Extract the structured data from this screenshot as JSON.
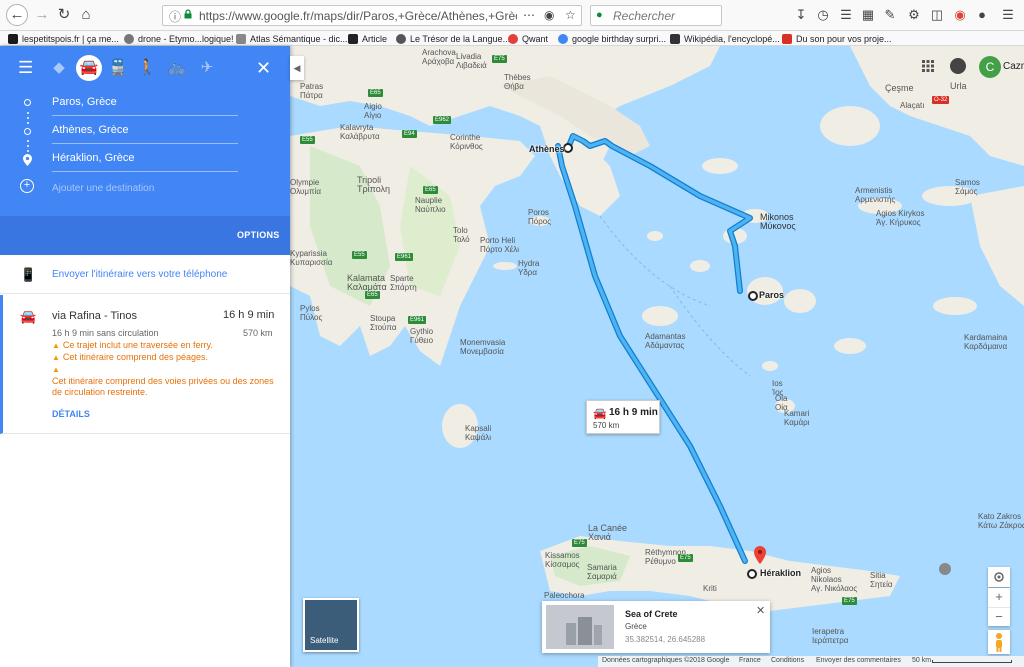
{
  "browser": {
    "url": "https://www.google.fr/maps/dir/Paros,+Grèce/Athènes,+Grèce/Hérakl",
    "search_placeholder": "Rechercher",
    "bookmarks": [
      {
        "label": "lespetitspois.fr | ça me...",
        "color": "#1b1b1b"
      },
      {
        "label": "drone - Etymo...logique!",
        "color": "#777777"
      },
      {
        "label": "Atlas Sémantique - dic...",
        "color": "#888888"
      },
      {
        "label": "Article",
        "color": "#222222"
      },
      {
        "label": "Le Trésor de la Langue...",
        "color": "#555555"
      },
      {
        "label": "Qwant",
        "color": "#e0413b"
      },
      {
        "label": "google birthday surpri...",
        "color": "#4285f4"
      },
      {
        "label": "Wikipédia, l'encyclopé...",
        "color": "#333333"
      },
      {
        "label": "Du son pour vos proje...",
        "color": "#d93025"
      }
    ]
  },
  "panel": {
    "colors": {
      "header": "#4285f4",
      "accent": "#4285f4",
      "warning": "#e8710a"
    },
    "modes": [
      "best-route",
      "car",
      "transit",
      "walk",
      "bike",
      "flight"
    ],
    "waypoints": [
      "Paros, Grèce",
      "Athènes, Grèce",
      "Héraklion, Grèce"
    ],
    "add_destination": "Ajouter une destination",
    "options": "OPTIONS",
    "send_to_phone": "Envoyer l'itinéraire vers votre téléphone",
    "route": {
      "via": "via Rafina - Tinos",
      "time": "16 h 9 min",
      "subtitle": "16 h 9 min sans circulation",
      "distance": "570 km",
      "warnings": [
        "Ce trajet inclut une traversée en ferry.",
        "Cet itinéraire comprend des péages.",
        "Cet itinéraire comprend des voies privées ou des zones de circulation restreinte."
      ],
      "details": "DÉTAILS"
    }
  },
  "map": {
    "route_card": {
      "time": "16 h 9 min",
      "distance": "570 km"
    },
    "places": {
      "athens": "Athènes",
      "paros": "Paros",
      "heraklion": "Héraklion"
    },
    "user_initial": "C",
    "user_name": "Cazmir",
    "satellite_label": "Satellite",
    "info_card": {
      "title": "Sea of Crete",
      "country": "Grèce",
      "coords": "35.382514, 26.645288"
    },
    "footer": {
      "data": "Données cartographiques ©2018 Google",
      "country": "France",
      "terms": "Conditions",
      "feedback": "Envoyer des commentaires",
      "scale": "50 km"
    },
    "labels": [
      {
        "id": "arachova",
        "text": "Arachova\nΑράχοβα"
      },
      {
        "id": "livadia",
        "text": "Livadia\nΛιβαδειά"
      },
      {
        "id": "thebes",
        "text": "Thèbes\nΘήβα"
      },
      {
        "id": "patras",
        "text": "Patras\nΠάτρα"
      },
      {
        "id": "aigio",
        "text": "Aigio\nΑίγιο"
      },
      {
        "id": "kalavryta",
        "text": "Kalavryta\nΚαλάβρυτα"
      },
      {
        "id": "corinthe",
        "text": "Corinthe\nΚόρινθος"
      },
      {
        "id": "olympie",
        "text": "Olympie\nΟλυμπία"
      },
      {
        "id": "tripoli",
        "text": "Tripoli\nΤρίπολη"
      },
      {
        "id": "nauplie",
        "text": "Nauplie\nΝαύπλιο"
      },
      {
        "id": "poros",
        "text": "Poros\nΠόρος"
      },
      {
        "id": "tolo",
        "text": "Tolo\nΤολό"
      },
      {
        "id": "porto-heli",
        "text": "Porto Heli\nΠόρτο Χέλι"
      },
      {
        "id": "hydra",
        "text": "Hydra\nΥδρα"
      },
      {
        "id": "kyparissia",
        "text": "Kyparissia\nΚυπαρισσία"
      },
      {
        "id": "kalamata",
        "text": "Kalamata\nΚαλαμάτα"
      },
      {
        "id": "sparte",
        "text": "Sparte\nΣπάρτη"
      },
      {
        "id": "pylos",
        "text": "Pylos\nΠύλος"
      },
      {
        "id": "stoupa",
        "text": "Stoupa\nΣτούπα"
      },
      {
        "id": "gythio",
        "text": "Gythio\nΓύθειο"
      },
      {
        "id": "monemvasia",
        "text": "Monemvasia\nΜονεμβασία"
      },
      {
        "id": "kapsali",
        "text": "Kapsali\nΚαψάλι"
      },
      {
        "id": "mykonos",
        "text": "Mikonos\nΜύκονος"
      },
      {
        "id": "adamantas",
        "text": "Adamantas\nΑδάμαντας"
      },
      {
        "id": "ios",
        "text": "Ios\nΊος"
      },
      {
        "id": "oia",
        "text": "Oia\nΟία"
      },
      {
        "id": "kamari",
        "text": "Kamari\nΚαμάρι"
      },
      {
        "id": "armenistis",
        "text": "Armenistis\nΑρμενιστής"
      },
      {
        "id": "agios-kirykos",
        "text": "Agios Kirykos\nΆγ. Κήρυκος"
      },
      {
        "id": "samos",
        "text": "Samos\nΣάμος"
      },
      {
        "id": "cesme",
        "text": "Çeşme"
      },
      {
        "id": "alacati",
        "text": "Alaçatı"
      },
      {
        "id": "urla",
        "text": "Urla"
      },
      {
        "id": "kardamaina",
        "text": "Kardamaina\nΚαρδάμαινα"
      },
      {
        "id": "la-canee",
        "text": "La Canée\nΧανιά"
      },
      {
        "id": "kissamos",
        "text": "Kissamos\nΚίσσαμος"
      },
      {
        "id": "rethymnon",
        "text": "Réthymnon\nΡέθυμνο"
      },
      {
        "id": "samaria",
        "text": "Samaria\nΣαμαριά"
      },
      {
        "id": "paleochora",
        "text": "Paleochora"
      },
      {
        "id": "kriti",
        "text": "Kriti"
      },
      {
        "id": "agios-nikolaos",
        "text": "Agios\nNikolaos\nΑγ. Νικόλαος"
      },
      {
        "id": "sitia",
        "text": "Sitia\nΣητεία"
      },
      {
        "id": "ierapetra",
        "text": "Ierapetra\nΙεράπετρα"
      },
      {
        "id": "katw-zakros",
        "text": "Kato Zakros\nΚάτω Ζάκρος"
      }
    ],
    "road_badges": [
      "E75",
      "E65",
      "E55",
      "E962",
      "E961",
      "E94",
      "E65",
      "E55",
      "E65",
      "E961",
      "E75",
      "E75",
      "E75",
      "O-32"
    ]
  }
}
